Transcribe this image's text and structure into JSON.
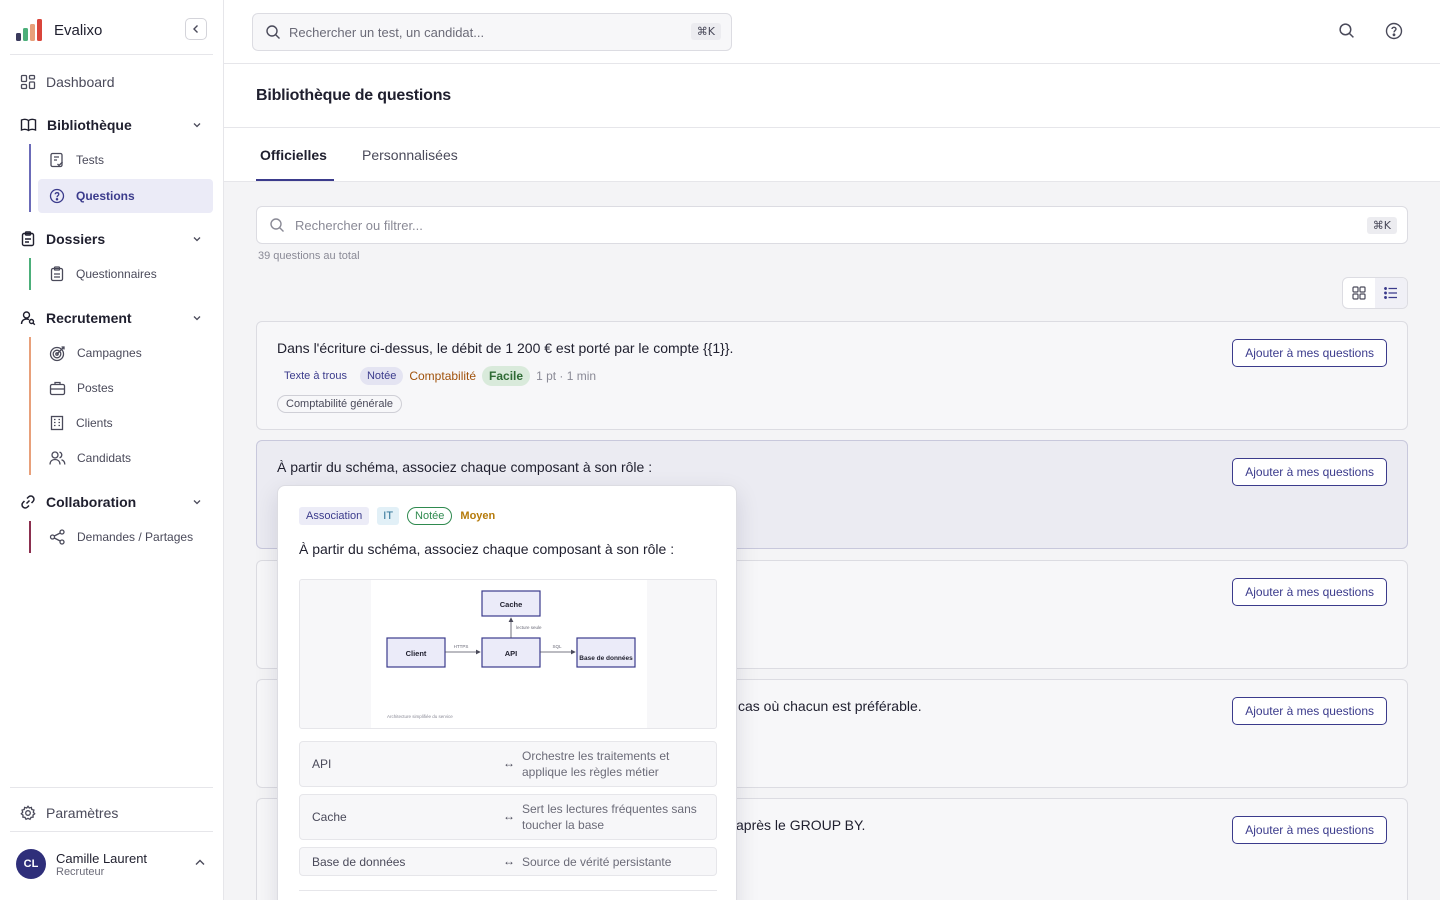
{
  "app": {
    "name": "Evalixo"
  },
  "sidebar": {
    "dashboard": "Dashboard",
    "library": {
      "label": "Bibliothèque",
      "items": [
        "Tests",
        "Questions"
      ]
    },
    "folders": {
      "label": "Dossiers",
      "items": [
        "Questionnaires"
      ]
    },
    "recruitment": {
      "label": "Recrutement",
      "items": [
        "Campagnes",
        "Postes",
        "Clients",
        "Candidats"
      ]
    },
    "collaboration": {
      "label": "Collaboration",
      "items": [
        "Demandes / Partages"
      ]
    },
    "settings": "Paramètres",
    "user": {
      "initials": "CL",
      "name": "Camille Laurent",
      "role": "Recruteur"
    },
    "accent_colors": {
      "library": "#6b6bb8",
      "folders": "#4caf7a",
      "recruitment": "#e8a07a",
      "collaboration": "#8b2f4f"
    }
  },
  "header": {
    "search_placeholder": "Rechercher un test, un candidat...",
    "shortcut": "⌘K"
  },
  "page": {
    "title": "Bibliothèque de questions",
    "tabs": [
      "Officielles",
      "Personnalisées"
    ],
    "active_tab": "Officielles",
    "filter_placeholder": "Rechercher ou filtrer...",
    "filter_shortcut": "⌘K",
    "count_text": "39 questions au total"
  },
  "questions": [
    {
      "text": "Dans l'écriture ci-dessus, le débit de 1 200 € est porté par le compte {{1}}.",
      "type": "Texte à trous",
      "graded": "Notée",
      "category": "Comptabilité",
      "difficulty": "Facile",
      "meta": "1 pt · 1 min",
      "subcategory": "Comptabilité générale",
      "button": "Ajouter à mes questions"
    },
    {
      "text": "À partir du schéma, associez chaque composant à son rôle :",
      "button": "Ajouter à mes questions"
    },
    {
      "text": "",
      "button": "Ajouter à mes questions"
    },
    {
      "text": "cas où chacun est préférable.",
      "button": "Ajouter à mes questions"
    },
    {
      "text": "après le GROUP BY.",
      "button": "Ajouter à mes questions"
    }
  ],
  "popover": {
    "tags": {
      "type": "Association",
      "domain": "IT",
      "graded": "Notée",
      "difficulty": "Moyen"
    },
    "title": "À partir du schéma, associez chaque composant à son rôle :",
    "diagram": {
      "nodes": [
        "Client",
        "API",
        "Cache",
        "Base de données"
      ],
      "edges": [
        "HTTPS",
        "SQL",
        "lecture seule"
      ],
      "caption": "Architecture simplifiée du service"
    },
    "pairs": [
      {
        "left": "API",
        "right": "Orchestre les traitements et applique les règles métier"
      },
      {
        "left": "Cache",
        "right": "Sert les lectures fréquentes sans toucher la base"
      },
      {
        "left": "Base de données",
        "right": "Source de vérité persistante"
      }
    ],
    "arrow": "↔"
  }
}
